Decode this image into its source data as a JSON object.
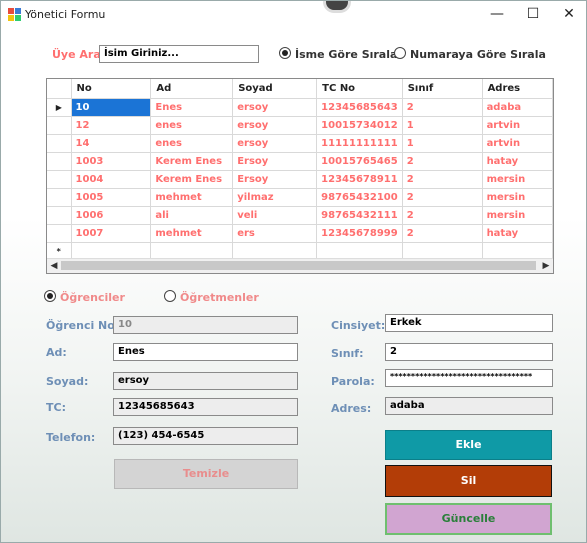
{
  "window": {
    "title": "Yönetici Formu",
    "minimize": "—",
    "maximize": "☐",
    "close": "✕"
  },
  "search": {
    "label": "Üye Ara:",
    "value": "İsim Giriniz..."
  },
  "sort": {
    "by_name": "İsme Göre Sırala",
    "by_number": "Numaraya Göre Sırala",
    "selected": "by_name"
  },
  "table": {
    "columns": [
      "No",
      "Ad",
      "Soyad",
      "TC No",
      "Sınıf",
      "Adres"
    ],
    "rows": [
      [
        "10",
        "Enes",
        "ersoy",
        "12345685643",
        "2",
        "adaba"
      ],
      [
        "12",
        "enes",
        "ersoy",
        "10015734012",
        "1",
        "artvin"
      ],
      [
        "14",
        "enes",
        "ersoy",
        "11111111111",
        "1",
        "artvin"
      ],
      [
        "1003",
        "Kerem Enes",
        "Ersoy",
        "10015765465",
        "2",
        "hatay"
      ],
      [
        "1004",
        "Kerem Enes",
        "Ersoy",
        "12345678911",
        "2",
        "mersin"
      ],
      [
        "1005",
        "mehmet",
        "yilmaz",
        "98765432100",
        "2",
        "mersin"
      ],
      [
        "1006",
        "ali",
        "veli",
        "98765432111",
        "2",
        "mersin"
      ],
      [
        "1007",
        "mehmet",
        "ers",
        "12345678999",
        "2",
        "hatay"
      ]
    ],
    "current_row_marker": "▶",
    "new_row_marker": "*"
  },
  "mode": {
    "students": "Öğrenciler",
    "teachers": "Öğretmenler",
    "selected": "students"
  },
  "form": {
    "student_no_label": "Öğrenci No:",
    "student_no": "10",
    "name_label": "Ad:",
    "name": "Enes",
    "surname_label": "Soyad:",
    "surname": "ersoy",
    "tc_label": "TC:",
    "tc": "12345685643",
    "phone_label": "Telefon:",
    "phone": "(123) 454-6545",
    "gender_label": "Cinsiyet:",
    "gender": "Erkek",
    "class_label": "Sınıf:",
    "class": "2",
    "password_label": "Parola:",
    "password": "**********************************",
    "address_label": "Adres:",
    "address": "adaba"
  },
  "buttons": {
    "clear": "Temizle",
    "add": "Ekle",
    "delete": "Sil",
    "update": "Güncelle"
  },
  "colors": {
    "add": "#0f9aa6",
    "delete": "#b33d07",
    "update": "#d1a5d1",
    "selection": "#1b74d6",
    "cell_text": "#ff6f6f"
  }
}
